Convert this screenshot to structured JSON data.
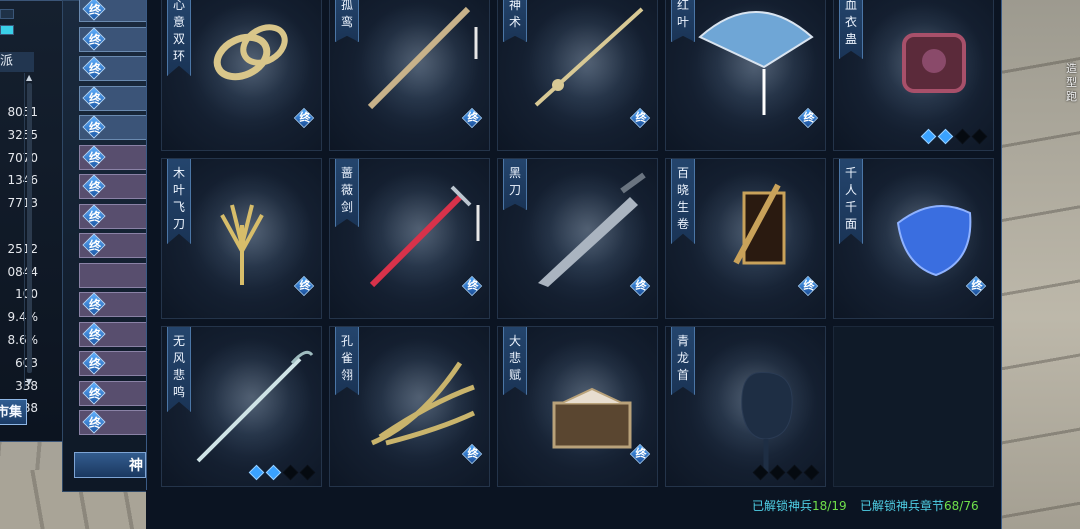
{
  "background": {
    "right_text": "造型跑"
  },
  "left_panel": {
    "section_label": "派",
    "stats": [
      "8051",
      "3255",
      "7070",
      "1346",
      "7713",
      "",
      "2512",
      "0844",
      "100",
      "9.4%",
      "8.6%",
      "603",
      "338",
      "3388"
    ],
    "market_button": "市集"
  },
  "tabs": {
    "items": [
      {
        "label": "终",
        "style": "blue"
      },
      {
        "label": "终",
        "style": "blue"
      },
      {
        "label": "终",
        "style": "blue"
      },
      {
        "label": "终",
        "style": "blue"
      },
      {
        "label": "终",
        "style": "blue"
      },
      {
        "label": "终",
        "style": "purple"
      },
      {
        "label": "终",
        "style": "purple"
      },
      {
        "label": "终",
        "style": "purple"
      },
      {
        "label": "终",
        "style": "purple"
      },
      {
        "label": "",
        "style": "purple"
      },
      {
        "label": "终",
        "style": "purple"
      },
      {
        "label": "终",
        "style": "purple"
      },
      {
        "label": "终",
        "style": "purple"
      },
      {
        "label": "终",
        "style": "purple"
      },
      {
        "label": "终",
        "style": "purple"
      }
    ],
    "bottom_button": "神"
  },
  "weapons": [
    {
      "name": "心意双环",
      "end_badge": "终",
      "stars": null,
      "icon": "twin-rings-icon",
      "accent": "#d9c68a"
    },
    {
      "name": "孤鸾",
      "end_badge": "终",
      "stars": null,
      "icon": "long-blade-icon",
      "accent": "#c8b28a"
    },
    {
      "name": "神术",
      "end_badge": "终",
      "stars": null,
      "icon": "staff-icon",
      "accent": "#d8c995"
    },
    {
      "name": "红叶",
      "end_badge": "终",
      "stars": null,
      "icon": "fan-icon",
      "accent": "#6fa6d6"
    },
    {
      "name": "血衣蛊",
      "end_badge": "",
      "stars": {
        "filled": 2,
        "total": 4
      },
      "icon": "gu-box-icon",
      "accent": "#a8506a"
    },
    {
      "name": "木叶飞刀",
      "end_badge": "终",
      "stars": null,
      "icon": "flying-knives-icon",
      "accent": "#d7bd6a"
    },
    {
      "name": "蔷薇剑",
      "end_badge": "终",
      "stars": null,
      "icon": "red-sword-icon",
      "accent": "#d8324a"
    },
    {
      "name": "黑刀",
      "end_badge": "终",
      "stars": null,
      "icon": "black-blade-icon",
      "accent": "#aab4c0"
    },
    {
      "name": "百晓生卷",
      "end_badge": "终",
      "stars": null,
      "icon": "scroll-icon",
      "accent": "#c9a25a"
    },
    {
      "name": "千人千面",
      "end_badge": "终",
      "stars": null,
      "icon": "mask-icon",
      "accent": "#3a6ee0"
    },
    {
      "name": "无风悲鸣",
      "end_badge": "",
      "stars": {
        "filled": 2,
        "total": 4
      },
      "icon": "white-sword-icon",
      "accent": "#cfe3e6"
    },
    {
      "name": "孔雀翎",
      "end_badge": "终",
      "stars": null,
      "icon": "peacock-feather-icon",
      "accent": "#c9b46c"
    },
    {
      "name": "大悲赋",
      "end_badge": "终",
      "stars": null,
      "icon": "book-box-icon",
      "accent": "#b9a27a"
    },
    {
      "name": "青龙首",
      "end_badge": "",
      "stars": {
        "filled": 0,
        "total": 4
      },
      "icon": "locked-silhouette-icon",
      "accent": "#1e2e44"
    }
  ],
  "footer": {
    "unlocked_label": "已解锁神兵",
    "unlocked_value": "18/19",
    "chapters_label": "已解锁神兵章节",
    "chapters_value": "68/76"
  }
}
